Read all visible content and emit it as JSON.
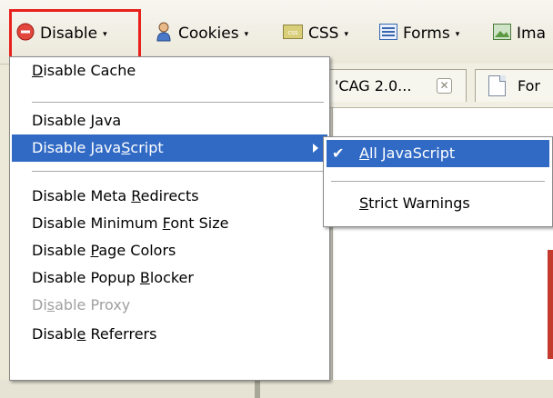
{
  "toolbar": {
    "buttons": [
      {
        "label": "Disable",
        "icon": "disable-icon"
      },
      {
        "label": "Cookies",
        "icon": "cookies-icon"
      },
      {
        "label": "CSS",
        "icon": "css-icon"
      },
      {
        "label": "Forms",
        "icon": "forms-icon"
      },
      {
        "label": "Ima",
        "icon": "images-icon"
      }
    ],
    "dropdown_indicator": "▾"
  },
  "tabs": [
    {
      "label": "'CAG 2.0...",
      "close": "✕"
    },
    {
      "label": "For"
    }
  ],
  "disable_menu": {
    "items": [
      {
        "label": "Disable Cache",
        "accelerator": "D"
      },
      {
        "label": "Disable Java",
        "accelerator": "J"
      },
      {
        "label": "Disable JavaScript",
        "accelerator": "S",
        "has_submenu": true,
        "active": true
      },
      {
        "label": "Disable Meta Redirects",
        "accelerator": "R"
      },
      {
        "label": "Disable Minimum Font Size",
        "accelerator": "F"
      },
      {
        "label": "Disable Page Colors",
        "accelerator": "P"
      },
      {
        "label": "Disable Popup Blocker",
        "accelerator": "B"
      },
      {
        "label": "Disable Proxy",
        "accelerator": "s",
        "disabled": true
      },
      {
        "label": "Disable Referrers",
        "accelerator": "e"
      }
    ]
  },
  "javascript_submenu": {
    "items": [
      {
        "label": "All JavaScript",
        "accelerator": "A",
        "checked": true,
        "active": true
      },
      {
        "label": "Strict Warnings",
        "accelerator": "S"
      }
    ]
  },
  "colors": {
    "highlight": "#316ac5",
    "annotation_border": "#e8211d"
  }
}
